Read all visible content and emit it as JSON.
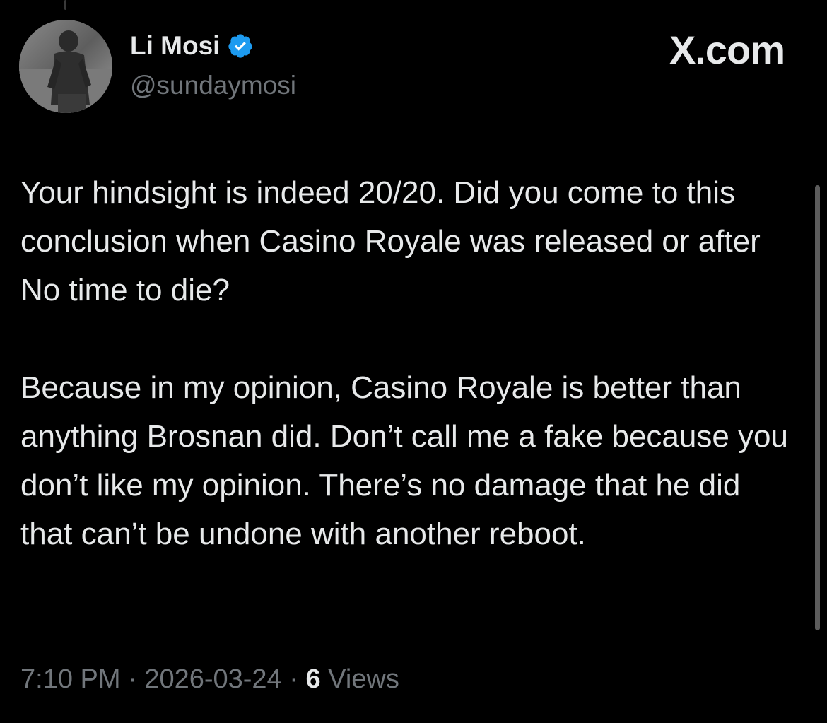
{
  "author": {
    "display_name": "Li Mosi",
    "handle": "@sundaymosi",
    "verified": true,
    "verified_icon": "verified-badge-icon",
    "verified_color": "#1d9bf0"
  },
  "brand": {
    "label": "X.com"
  },
  "tweet": {
    "paragraphs": [
      "Your hindsight is indeed 20/20. Did you come to this conclusion when Casino Royale was released or after No time to die?",
      "Because in my opinion, Casino Royale is better than anything Brosnan did. Don’t call me a fake because you don’t like my opinion. There’s no damage that he did that can’t be undone with another reboot."
    ]
  },
  "meta": {
    "time": "7:10 PM",
    "separator": " · ",
    "date": "2026-03-24",
    "views_count": "6",
    "views_label": " Views"
  },
  "colors": {
    "background": "#000000",
    "text_primary": "#e7e9ea",
    "text_secondary": "#71767b"
  }
}
